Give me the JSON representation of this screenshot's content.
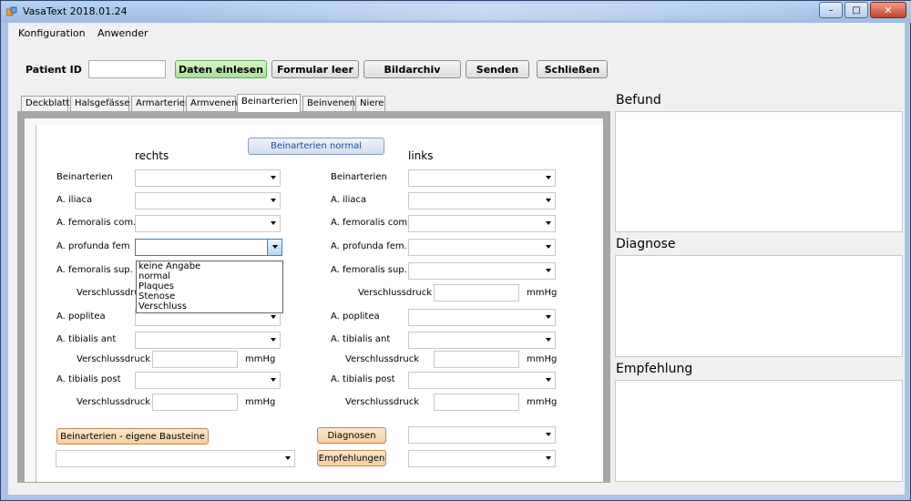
{
  "window": {
    "title": "VasaText  2018.01.24",
    "controls": {
      "minimize": "–",
      "maximize": "□",
      "close": "✕"
    }
  },
  "menu": [
    "Konfiguration",
    "Anwender"
  ],
  "toolbar": {
    "patient_label": "Patient ID",
    "patient_value": "",
    "buttons": [
      "Daten einlesen",
      "Formular leer",
      "Bildarchiv",
      "Senden",
      "Schließen"
    ]
  },
  "tabs": [
    "Deckblatt",
    "Halsgefässe",
    "Armarterien",
    "Armvenen",
    "Beinarterien",
    "Beinvenen",
    "Niere"
  ],
  "active_tab": "Beinarterien",
  "panel": {
    "normal_button": "Beinarterien normal",
    "rechts_header": "rechts",
    "links_header": "links",
    "rechts": {
      "beinarterien": "Beinarterien",
      "iliaca": "A. iliaca",
      "femoralis_com": "A. femoralis com.",
      "profunda": "A. profunda fem",
      "femoralis_sup": "A. femoralis sup.",
      "verschlussdruck_1": "Verschlussdruck",
      "poplitea": "A. poplitea",
      "tibialis_ant": "A. tibialis ant",
      "verschlussdruck_2": "Verschlussdruck",
      "tibialis_post": "A. tibialis post",
      "verschlussdruck_3": "Verschlussdruck"
    },
    "links": {
      "beinarterien": "Beinarterien",
      "iliaca": "A. iliaca",
      "femoralis_com": "A. femoralis com.",
      "profunda": "A. profunda fem.",
      "femoralis_sup": "A. femoralis sup.",
      "verschlussdruck_1": "Verschlussdruck",
      "poplitea": "A. poplitea",
      "tibialis_ant": "A. tibialis ant",
      "verschlussdruck_2": "Verschlussdruck",
      "tibialis_post": "A. tibialis post",
      "verschlussdruck_3": "Verschlussdruck"
    },
    "unit": "mmHg",
    "dropdown_options": [
      "keine Angabe",
      "normal",
      "Plaques",
      "Stenose",
      "Verschluss"
    ],
    "eigene_bausteine_button": "Beinarterien - eigene Bausteine",
    "diagnosen_button": "Diagnosen",
    "empfehlungen_button": "Empfehlungen"
  },
  "right": {
    "befund": "Befund",
    "diagnose": "Diagnose",
    "empfehlung": "Empfehlung"
  },
  "colors": {
    "window_frame": "#a9c3e6",
    "client_bg": "#f0f0f0",
    "green_button": "#a9e29a",
    "peach_button": "#f7ce9f"
  }
}
